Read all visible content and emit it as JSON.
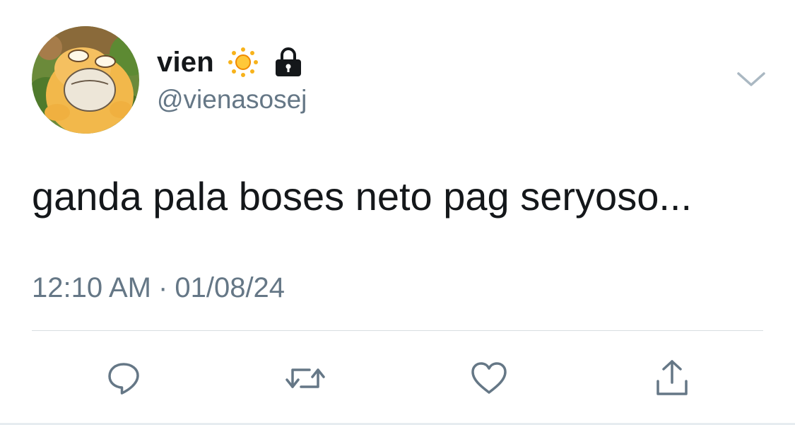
{
  "tweet": {
    "display_name": "vien",
    "handle": "@vienasosej",
    "badges": [
      "sun-emoji-icon",
      "lock-icon"
    ],
    "text": "ganda pala boses neto pag seryoso...",
    "time": "12:10 AM",
    "separator": "·",
    "date": "01/08/24"
  },
  "actions": [
    "reply-icon",
    "retweet-icon",
    "like-icon",
    "share-icon"
  ],
  "colors": {
    "text": "#14171a",
    "secondary": "#657786",
    "divider": "#d8dde1",
    "icon": "#657786"
  }
}
